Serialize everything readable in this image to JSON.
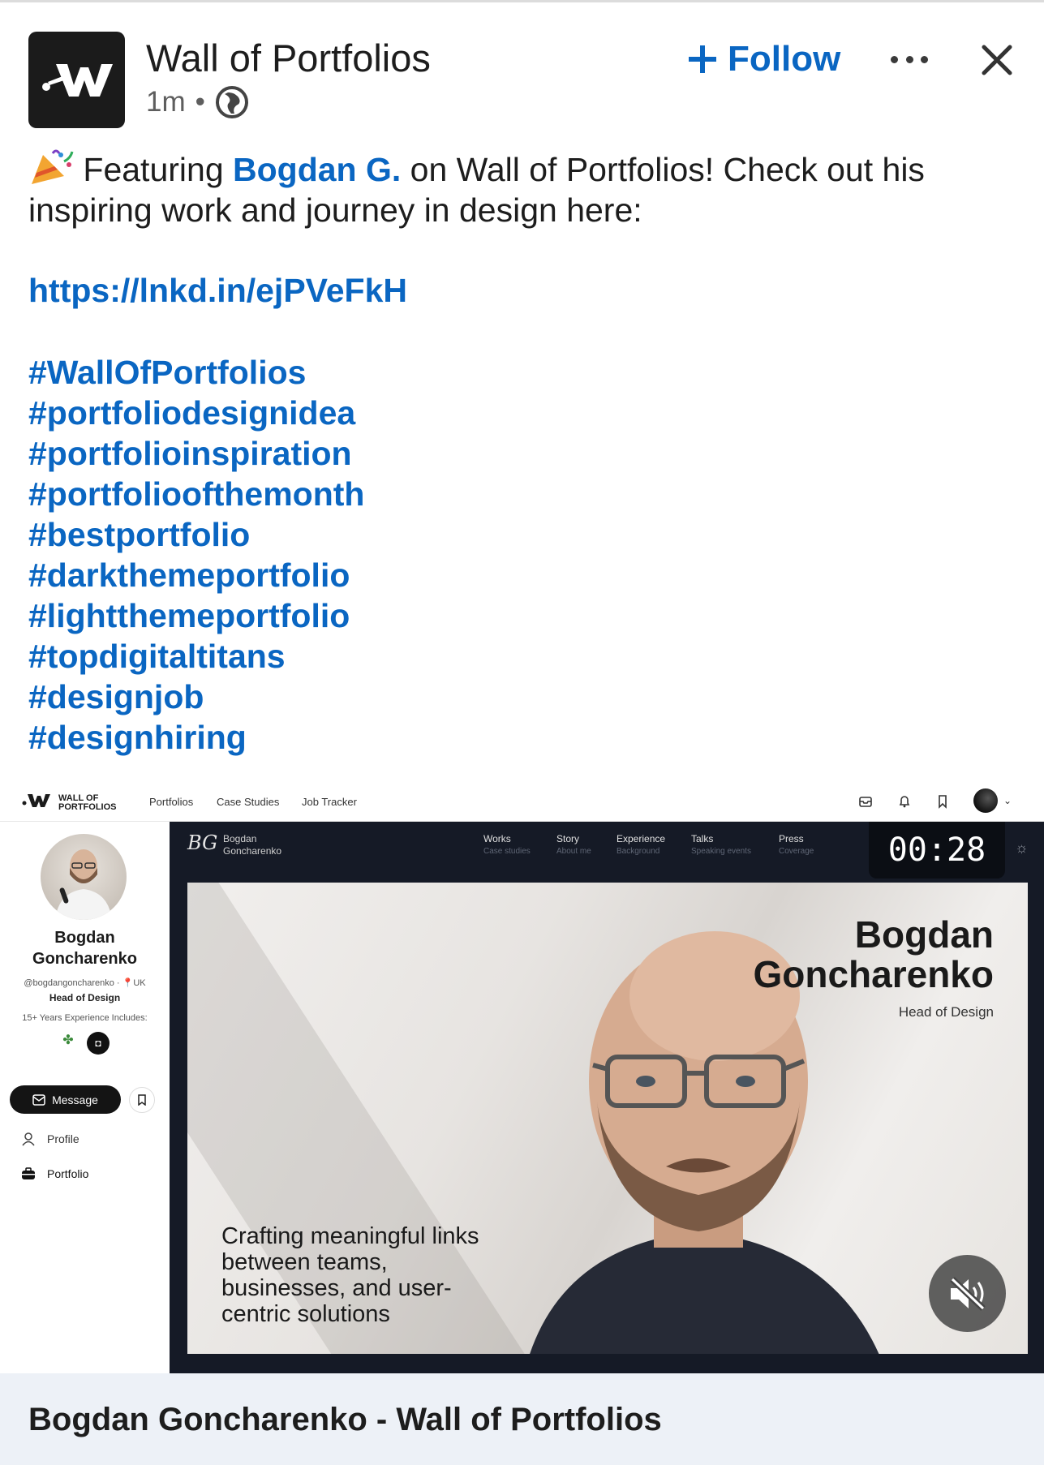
{
  "post": {
    "author": "Wall of Portfolios",
    "time": "1m",
    "separator": "•",
    "follow_label": "Follow",
    "text_before": "Featuring ",
    "mention": "Bogdan G.",
    "text_after": " on Wall of Portfolios! Check out his inspiring work and journey in design here:",
    "link": "https://lnkd.in/ejPVeFkH",
    "hashtags": [
      "#WallOfPortfolios",
      "#portfoliodesignidea",
      "#portfolioinspiration",
      "#portfolioofthemonth",
      "#bestportfolio",
      "#darkthemeportfolio",
      "#lightthemeportfolio",
      "#topdigitaltitans",
      "#designjob",
      "#designhiring"
    ],
    "icons": {
      "logo": "wall-of-portfolios-logo",
      "audience": "globe-icon",
      "follow": "plus-icon",
      "more": "more-icon",
      "close": "close-icon",
      "emoji": "party-popper-emoji"
    },
    "accent_color": "#0a66c2"
  },
  "media": {
    "site": {
      "logo_text_1": "WALL OF",
      "logo_text_2": "PORTFOLIOS",
      "nav": [
        "Portfolios",
        "Case Studies",
        "Job Tracker"
      ]
    },
    "profile": {
      "name_line1": "Bogdan",
      "name_line2": "Goncharenko",
      "handle": "@bogdangoncharenko · 📍UK",
      "role": "Head of Design",
      "experience": "15+ Years Experience Includes:",
      "message_label": "Message",
      "menu": [
        "Profile",
        "Portfolio"
      ]
    },
    "portfolio": {
      "brand_line1": "Bogdan",
      "brand_line2": "Goncharenko",
      "logo_glyph": "BG",
      "nav": [
        {
          "title": "Works",
          "sub": "Case studies"
        },
        {
          "title": "Story",
          "sub": "About me"
        },
        {
          "title": "Experience",
          "sub": "Background"
        },
        {
          "title": "Talks",
          "sub": "Speaking events"
        },
        {
          "title": "Press",
          "sub": "Coverage"
        }
      ],
      "timer": "00:28",
      "hero_name_line1": "Bogdan",
      "hero_name_line2": "Goncharenko",
      "hero_role": "Head of Design",
      "tagline": "Crafting meaningful links between teams, businesses, and user-centric solutions"
    },
    "muted": true
  },
  "caption": "Bogdan Goncharenko - Wall of Portfolios"
}
